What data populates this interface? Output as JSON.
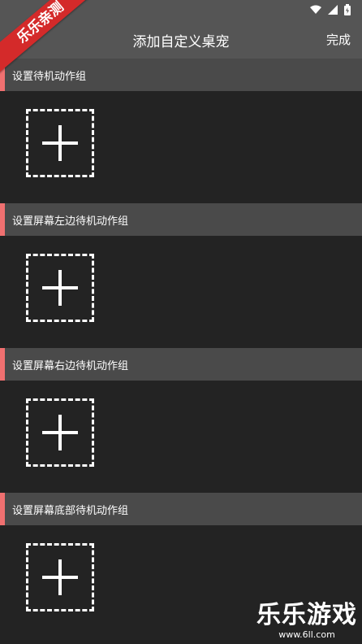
{
  "app_bar": {
    "title": "添加自定义桌宠",
    "done_label": "完成"
  },
  "sections": [
    {
      "label": "设置待机动作组"
    },
    {
      "label": "设置屏幕左边待机动作组"
    },
    {
      "label": "设置屏幕右边待机动作组"
    },
    {
      "label": "设置屏幕底部待机动作组"
    }
  ],
  "overlays": {
    "corner_badge": "乐乐亲测",
    "watermark_title": "乐乐游戏",
    "watermark_url": "www.6ll.com"
  },
  "colors": {
    "accent": "#f07070",
    "header_bg": "#555555",
    "section_header_bg": "#4a4a4a",
    "body_bg": "#232323",
    "badge_red": "#d42a2a"
  }
}
